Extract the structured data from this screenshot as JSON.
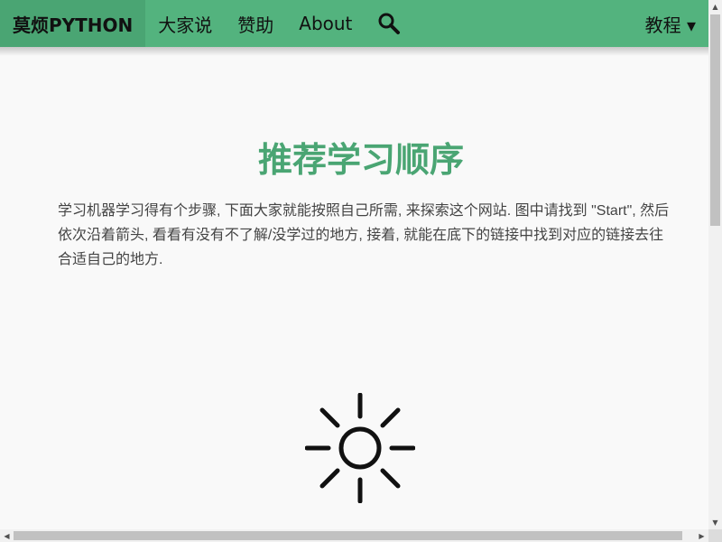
{
  "navbar": {
    "brand": "莫烦PYTHON",
    "items": [
      "大家说",
      "赞助",
      "About"
    ],
    "search_icon": "search-icon",
    "right_menu": "教程 ▾",
    "bg_color": "#53b37e",
    "brand_bg_color": "#4aa573"
  },
  "main": {
    "title": "推荐学习顺序",
    "intro": "学习机器学习得有个步骤, 下面大家就能按照自己所需, 来探索这个网站. 图中请找到 \"Start\", 然后依次沿着箭头, 看看有没有不了解/没学过的地方, 接着, 就能在底下的链接中找到对应的链接去往合适自己的地方.",
    "graphic_icon": "sun-icon",
    "title_color": "#4aa573"
  },
  "scrollbars": {
    "vertical_up": "▲",
    "vertical_down": "▼",
    "horizontal_left": "◀",
    "horizontal_right": "▶"
  }
}
